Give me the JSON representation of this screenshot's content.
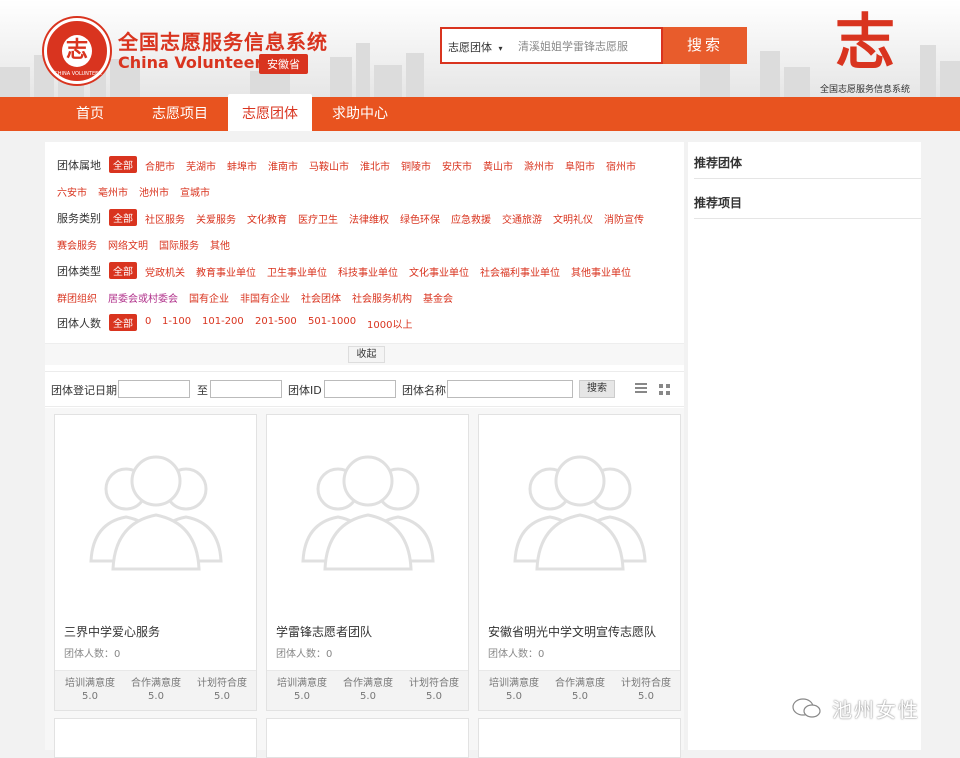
{
  "header": {
    "logo_text": "志",
    "logo_ring": "CHINA VOLUNTEER",
    "title": "全国志愿服务信息系统",
    "subtitle": "China Volunteer",
    "province": "安徽省",
    "search": {
      "type_label": "志愿团体",
      "type_arrow": "▾",
      "value": "清溪姐姐学雷锋志愿服",
      "button": "搜索"
    },
    "brand_logo": "志",
    "brand_caption": "全国志愿服务信息系统"
  },
  "nav": {
    "items": [
      {
        "label": "首页"
      },
      {
        "label": "志愿项目"
      },
      {
        "label": "志愿团体"
      },
      {
        "label": "求助中心"
      }
    ],
    "active_index": 2
  },
  "filters": {
    "area": {
      "label": "团体属地",
      "all": "全部",
      "options": [
        "合肥市",
        "芜湖市",
        "蚌埠市",
        "淮南市",
        "马鞍山市",
        "淮北市",
        "铜陵市",
        "安庆市",
        "黄山市",
        "滁州市",
        "阜阳市",
        "宿州市",
        "六安市",
        "亳州市",
        "池州市",
        "宣城市"
      ]
    },
    "service": {
      "label": "服务类别",
      "all": "全部",
      "options": [
        "社区服务",
        "关爱服务",
        "文化教育",
        "医疗卫生",
        "法律维权",
        "绿色环保",
        "应急救援",
        "交通旅游",
        "文明礼仪",
        "消防宣传",
        "赛会服务",
        "网络文明",
        "国际服务",
        "其他"
      ]
    },
    "type": {
      "label": "团体类型",
      "all": "全部",
      "options": [
        "党政机关",
        "教育事业单位",
        "卫生事业单位",
        "科技事业单位",
        "文化事业单位",
        "社会福利事业单位",
        "其他事业单位",
        "群团组织",
        "居委会或村委会",
        "国有企业",
        "非国有企业",
        "社会团体",
        "社会服务机构",
        "基金会"
      ]
    },
    "size": {
      "label": "团体人数",
      "all": "全部",
      "options": [
        "0",
        "1-100",
        "101-200",
        "201-500",
        "501-1000",
        "1000以上"
      ]
    },
    "collapse": "收起"
  },
  "search_row": {
    "date_label": "团体登记日期",
    "to_label": "至",
    "id_label": "团体ID",
    "name_label": "团体名称",
    "button": "搜索"
  },
  "cards": [
    {
      "name": "三界中学爱心服务",
      "count": "团体人数：0",
      "stats": [
        {
          "label": "培训满意度",
          "value": "5.0"
        },
        {
          "label": "合作满意度",
          "value": "5.0"
        },
        {
          "label": "计划符合度",
          "value": "5.0"
        }
      ]
    },
    {
      "name": "学雷锋志愿者团队",
      "count": "团体人数：0",
      "stats": [
        {
          "label": "培训满意度",
          "value": "5.0"
        },
        {
          "label": "合作满意度",
          "value": "5.0"
        },
        {
          "label": "计划符合度",
          "value": "5.0"
        }
      ]
    },
    {
      "name": "安徽省明光中学文明宣传志愿队",
      "count": "团体人数：0",
      "stats": [
        {
          "label": "培训满意度",
          "value": "5.0"
        },
        {
          "label": "合作满意度",
          "value": "5.0"
        },
        {
          "label": "计划符合度",
          "value": "5.0"
        }
      ]
    }
  ],
  "sidebar": {
    "recommended_groups": "推荐团体",
    "recommended_projects": "推荐项目"
  },
  "watermark": "池州女性",
  "colors": {
    "brand_red": "#d9341f",
    "nav_orange": "#e8531f",
    "search_button": "#e85c2c",
    "purple_option": "#b0308a"
  }
}
